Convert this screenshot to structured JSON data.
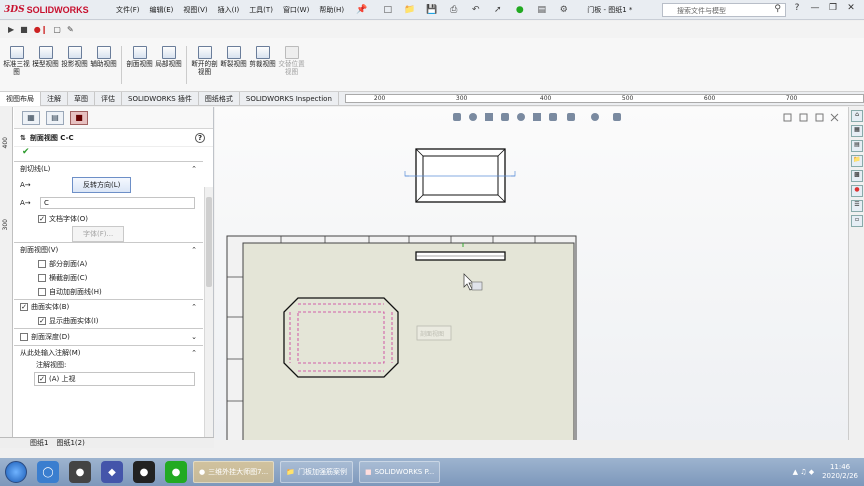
{
  "app": {
    "brand_prefix": "3DS",
    "brand": "SOLIDWORKS",
    "doc_title": "门板 - 图纸1 *"
  },
  "menu": [
    "文件(F)",
    "编辑(E)",
    "视图(V)",
    "插入(I)",
    "工具(T)",
    "窗口(W)",
    "帮助(H)"
  ],
  "search": {
    "placeholder": "搜索文件与模型"
  },
  "commands": [
    {
      "label": "标准三视图",
      "disabled": false
    },
    {
      "label": "模型视图",
      "disabled": false
    },
    {
      "label": "投影视图",
      "disabled": false
    },
    {
      "label": "辅助视图",
      "disabled": false
    },
    {
      "label": "剖面视图",
      "disabled": false
    },
    {
      "label": "局部视图",
      "disabled": false
    },
    {
      "label": "断开的剖视图",
      "disabled": false
    },
    {
      "label": "断裂视图",
      "disabled": false
    },
    {
      "label": "剪裁视图",
      "disabled": false
    },
    {
      "label": "交替位置视图",
      "disabled": true
    }
  ],
  "tabs": [
    "视图布局",
    "注解",
    "草图",
    "评估",
    "SOLIDWORKS 插件",
    "图纸格式",
    "SOLIDWORKS Inspection"
  ],
  "ruler_top": [
    "200",
    "300",
    "400",
    "500",
    "600",
    "700"
  ],
  "ruler_left": [
    "400",
    "300"
  ],
  "property_manager": {
    "title": "剖面视图 C-C",
    "cutting_line": {
      "header": "剖切线(L)",
      "reverse_button": "反转方向(L)",
      "label_value": "C",
      "doc_font": "文档字体(O)",
      "font_button": "字体(F)..."
    },
    "section_view": {
      "header": "剖面视图(V)",
      "options": [
        {
          "label": "部分剖面(A)",
          "checked": false
        },
        {
          "label": "横截剖面(C)",
          "checked": false
        },
        {
          "label": "自动加剖面线(H)",
          "checked": false
        }
      ]
    },
    "surface_bodies": {
      "header": "曲面实体(B)",
      "checked": true,
      "option": "显示曲面实体(I)",
      "option_checked": true
    },
    "section_depth": {
      "header": "剖面深度(D)",
      "checked": false
    },
    "import_annotations": {
      "header": "从此处输入注解(M)",
      "sub": "注解视图:",
      "item": "(A) 上视",
      "item_checked": true
    }
  },
  "sheet_tabs": [
    "图纸1",
    "图纸1(2)"
  ],
  "graphics": {
    "ghost_label": "剖面视图"
  },
  "taskbar": {
    "items": [
      {
        "label": "三维外挂大师图7...",
        "active": true
      },
      {
        "label": "门板加强筋案例",
        "active": false
      },
      {
        "label": "SOLIDWORKS P...",
        "active": false
      }
    ],
    "time": "11:46",
    "date": "2020/2/26"
  }
}
